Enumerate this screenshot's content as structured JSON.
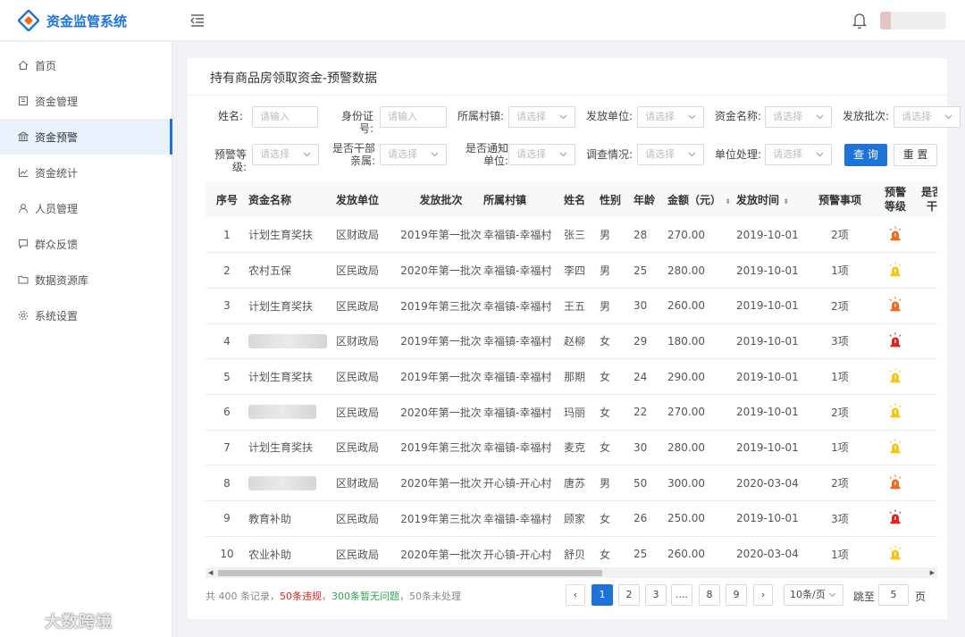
{
  "app": {
    "title": "资金监管系统"
  },
  "sidebar": {
    "items": [
      {
        "label": "首页",
        "icon": "home-icon",
        "active": false
      },
      {
        "label": "资金管理",
        "icon": "fund-icon",
        "active": false
      },
      {
        "label": "资金预警",
        "icon": "bank-icon",
        "active": true
      },
      {
        "label": "资金统计",
        "icon": "chart-icon",
        "active": false
      },
      {
        "label": "人员管理",
        "icon": "user-icon",
        "active": false
      },
      {
        "label": "群众反馈",
        "icon": "feedback-icon",
        "active": false
      },
      {
        "label": "数据资源库",
        "icon": "folder-icon",
        "active": false
      },
      {
        "label": "系统设置",
        "icon": "gear-icon",
        "active": false
      }
    ]
  },
  "panel": {
    "title": "持有商品房领取资金-预警数据"
  },
  "filters": {
    "name_label": "姓名:",
    "name_placeholder": "请输入",
    "id_label": "身份证号:",
    "id_placeholder": "请输入",
    "village_label": "所属村镇:",
    "village_value": "请选择",
    "issuer_label": "发放单位:",
    "issuer_value": "请选择",
    "fund_label": "资金名称:",
    "fund_value": "请选择",
    "batch_label": "发放批次:",
    "batch_value": "请选择",
    "level_label": "预警等级:",
    "level_value": "请选择",
    "cadre_label_1": "是否干部",
    "cadre_label_2": "亲属:",
    "cadre_value": "请选择",
    "notified_label_1": "是否通知",
    "notified_label_2": "单位:",
    "notified_value": "请选择",
    "survey_label": "调查情况:",
    "survey_value": "请选择",
    "unit_label": "单位处理:",
    "unit_value": "请选择",
    "query_label": "查 询",
    "reset_label": "重 置"
  },
  "table": {
    "headers": {
      "no": "序号",
      "fund": "资金名称",
      "issuer": "发放单位",
      "batch": "发放批次",
      "village": "所属村镇",
      "name": "姓名",
      "gender": "性别",
      "age": "年龄",
      "amount": "金额（元）",
      "time": "发放时间",
      "items": "预警事项",
      "level_1": "预警",
      "level_2": "等级",
      "extra_1": "是否",
      "extra_2": "干"
    },
    "sort_glyph": "⬍",
    "rows": [
      {
        "no": "1",
        "fund": "计划生育奖扶",
        "fund_blurred": false,
        "issuer": "区财政局",
        "batch": "2019年第一批次",
        "village": "幸福镇-幸福村",
        "name": "张三",
        "gender": "男",
        "age": "28",
        "amount": "270.00",
        "time": "2019-10-01",
        "items": "2项",
        "level": "orange"
      },
      {
        "no": "2",
        "fund": "农村五保",
        "fund_blurred": false,
        "issuer": "区民政局",
        "batch": "2020年第一批次",
        "village": "幸福镇-幸福村",
        "name": "李四",
        "gender": "男",
        "age": "25",
        "amount": "280.00",
        "time": "2019-10-01",
        "items": "1项",
        "level": "yellow"
      },
      {
        "no": "3",
        "fund": "计划生育奖扶",
        "fund_blurred": false,
        "issuer": "区民政局",
        "batch": "2019年第三批次",
        "village": "幸福镇-幸福村",
        "name": "王五",
        "gender": "男",
        "age": "30",
        "amount": "260.00",
        "time": "2019-10-01",
        "items": "2项",
        "level": "orange"
      },
      {
        "no": "4",
        "fund": "",
        "fund_blurred": true,
        "issuer": "区财政局",
        "batch": "2019年第一批次",
        "village": "幸福镇-幸福村",
        "name": "赵柳",
        "gender": "女",
        "age": "29",
        "amount": "180.00",
        "time": "2019-10-01",
        "items": "3项",
        "level": "red"
      },
      {
        "no": "5",
        "fund": "计划生育奖扶",
        "fund_blurred": false,
        "issuer": "区民政局",
        "batch": "2019年第一批次",
        "village": "幸福镇-幸福村",
        "name": "那期",
        "gender": "女",
        "age": "24",
        "amount": "290.00",
        "time": "2019-10-01",
        "items": "1项",
        "level": "yellow"
      },
      {
        "no": "6",
        "fund": "",
        "fund_blurred": true,
        "issuer": "区民政局",
        "batch": "2020年第一批次",
        "village": "幸福镇-幸福村",
        "name": "玛丽",
        "gender": "女",
        "age": "22",
        "amount": "270.00",
        "time": "2019-10-01",
        "items": "2项",
        "level": "yellow"
      },
      {
        "no": "7",
        "fund": "计划生育奖扶",
        "fund_blurred": false,
        "issuer": "区民政局",
        "batch": "2019年第三批次",
        "village": "幸福镇-幸福村",
        "name": "麦克",
        "gender": "女",
        "age": "30",
        "amount": "280.00",
        "time": "2019-10-01",
        "items": "1项",
        "level": "yellow"
      },
      {
        "no": "8",
        "fund": "",
        "fund_blurred": true,
        "issuer": "区财政局",
        "batch": "2020年第一批次",
        "village": "开心镇-开心村",
        "name": "唐苏",
        "gender": "男",
        "age": "50",
        "amount": "300.00",
        "time": "2020-03-04",
        "items": "2项",
        "level": "orange"
      },
      {
        "no": "9",
        "fund": "教育补助",
        "fund_blurred": false,
        "issuer": "区民政局",
        "batch": "2019年第三批次",
        "village": "幸福镇-幸福村",
        "name": "顾家",
        "gender": "女",
        "age": "26",
        "amount": "250.00",
        "time": "2019-10-01",
        "items": "3项",
        "level": "red"
      },
      {
        "no": "10",
        "fund": "农业补助",
        "fund_blurred": false,
        "issuer": "区民政局",
        "batch": "2020年第一批次",
        "village": "开心镇-开心村",
        "name": "舒贝",
        "gender": "女",
        "age": "25",
        "amount": "260.00",
        "time": "2020-03-04",
        "items": "1项",
        "level": "yellow"
      }
    ]
  },
  "summary": {
    "prefix": "共 400 条记录，",
    "violations": "50条违规",
    "sep1": "，",
    "ok": "300条暂无问题",
    "rest": "，50条未处理"
  },
  "pagination": {
    "prev": "‹",
    "next": "›",
    "pages": [
      "1",
      "2",
      "3",
      "....",
      "8",
      "9"
    ],
    "active_page": "1",
    "page_size": "10条/页",
    "goto_label": "跳至",
    "goto_value": "5",
    "page_unit": "页"
  },
  "watermark": {
    "text": "大数跨境"
  },
  "colors": {
    "primary": "#1e73d8",
    "alarm_red": "#e0251d",
    "alarm_orange": "#f06a1d",
    "alarm_yellow": "#f5c518"
  }
}
